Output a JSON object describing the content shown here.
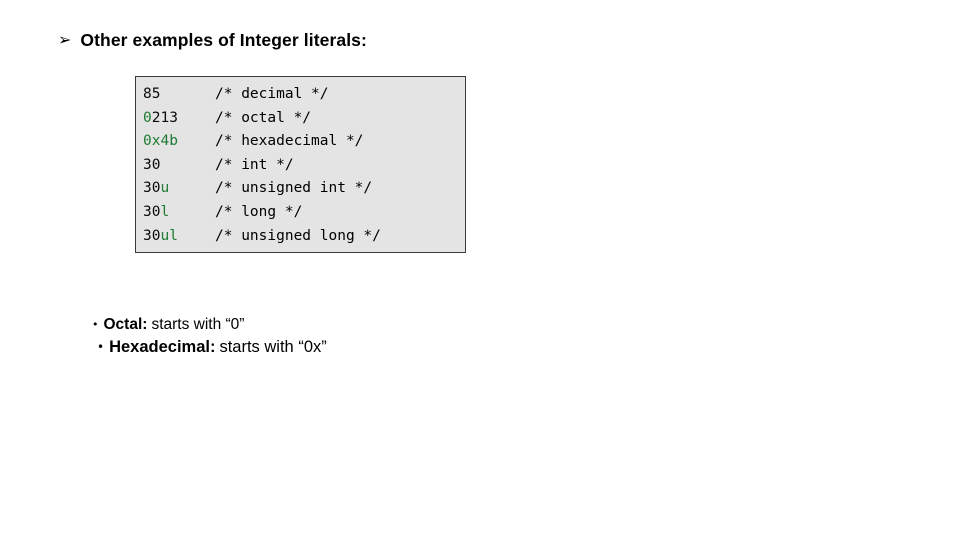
{
  "slide": {
    "background_color": "#ffffff",
    "heading": {
      "marker_glyph": "➢",
      "marker_name": "wingdings-arrow-bullet",
      "text": "Other examples of Integer literals:"
    },
    "code_block": {
      "background_color": "#e4e4e4",
      "border_color": "#3a3a3a",
      "literal_accent_color": "#1f7a32",
      "text_color": "#0b0b0b",
      "lines": [
        {
          "literal_prefix": "",
          "literal_accent": "",
          "literal_suffix": "85",
          "comment": "/* decimal */"
        },
        {
          "literal_prefix": "",
          "literal_accent": "0",
          "literal_suffix": "213",
          "comment": "/* octal */"
        },
        {
          "literal_prefix": "",
          "literal_accent": "0x4b",
          "literal_suffix": "",
          "comment": "/* hexadecimal */"
        },
        {
          "literal_prefix": "30",
          "literal_accent": "",
          "literal_suffix": "",
          "comment": "/* int */"
        },
        {
          "literal_prefix": "30",
          "literal_accent": "u",
          "literal_suffix": "",
          "comment": "/* unsigned int */"
        },
        {
          "literal_prefix": "30",
          "literal_accent": "l",
          "literal_suffix": "",
          "comment": "/* long */"
        },
        {
          "literal_prefix": "30",
          "literal_accent": "ul",
          "literal_suffix": "",
          "comment": "/* unsigned long */"
        }
      ]
    },
    "bullets": [
      {
        "marker_glyph": "•",
        "label": "Octal:",
        "text": "starts with “0”"
      },
      {
        "marker_glyph": "•",
        "label": "Hexadecimal:",
        "text": "starts with “0x”"
      }
    ]
  }
}
